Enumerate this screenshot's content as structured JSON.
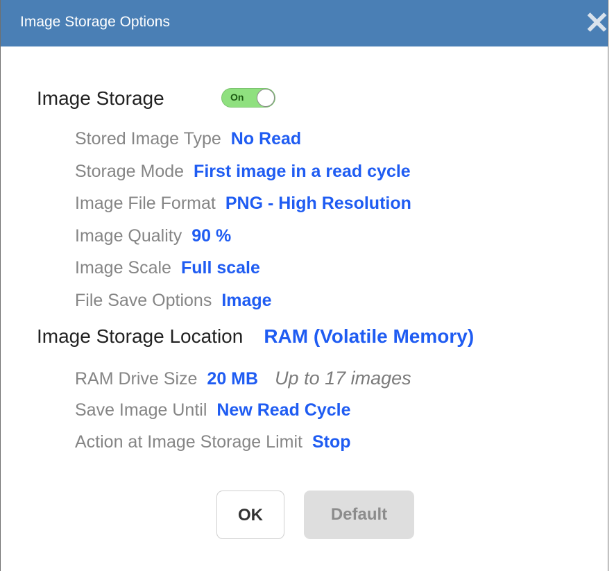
{
  "dialog": {
    "title": "Image Storage Options",
    "close_glyph": "✕",
    "close_icon": "close-icon"
  },
  "image_storage": {
    "label": "Image Storage",
    "toggle_label": "On",
    "toggle_state": "on"
  },
  "settings": [
    {
      "label": "Stored Image Type",
      "value": "No Read"
    },
    {
      "label": "Storage Mode",
      "value": "First image in a read cycle"
    },
    {
      "label": "Image File Format",
      "value": "PNG - High Resolution"
    },
    {
      "label": "Image Quality",
      "value": "90 %"
    },
    {
      "label": "Image Scale",
      "value": "Full scale"
    },
    {
      "label": "File Save Options",
      "value": "Image"
    }
  ],
  "location": {
    "label": "Image Storage Location",
    "value": "RAM (Volatile Memory)"
  },
  "location_settings": [
    {
      "label": "RAM Drive Size",
      "value": "20 MB",
      "note": "Up to 17 images"
    },
    {
      "label": "Save Image Until",
      "value": "New Read Cycle"
    },
    {
      "label": "Action at Image Storage Limit",
      "value": "Stop"
    }
  ],
  "buttons": {
    "ok": "OK",
    "default": "Default"
  },
  "colors": {
    "titlebar": "#4a7fb5",
    "value_blue": "#1f5cf2",
    "toggle_on": "#8fe07f"
  }
}
